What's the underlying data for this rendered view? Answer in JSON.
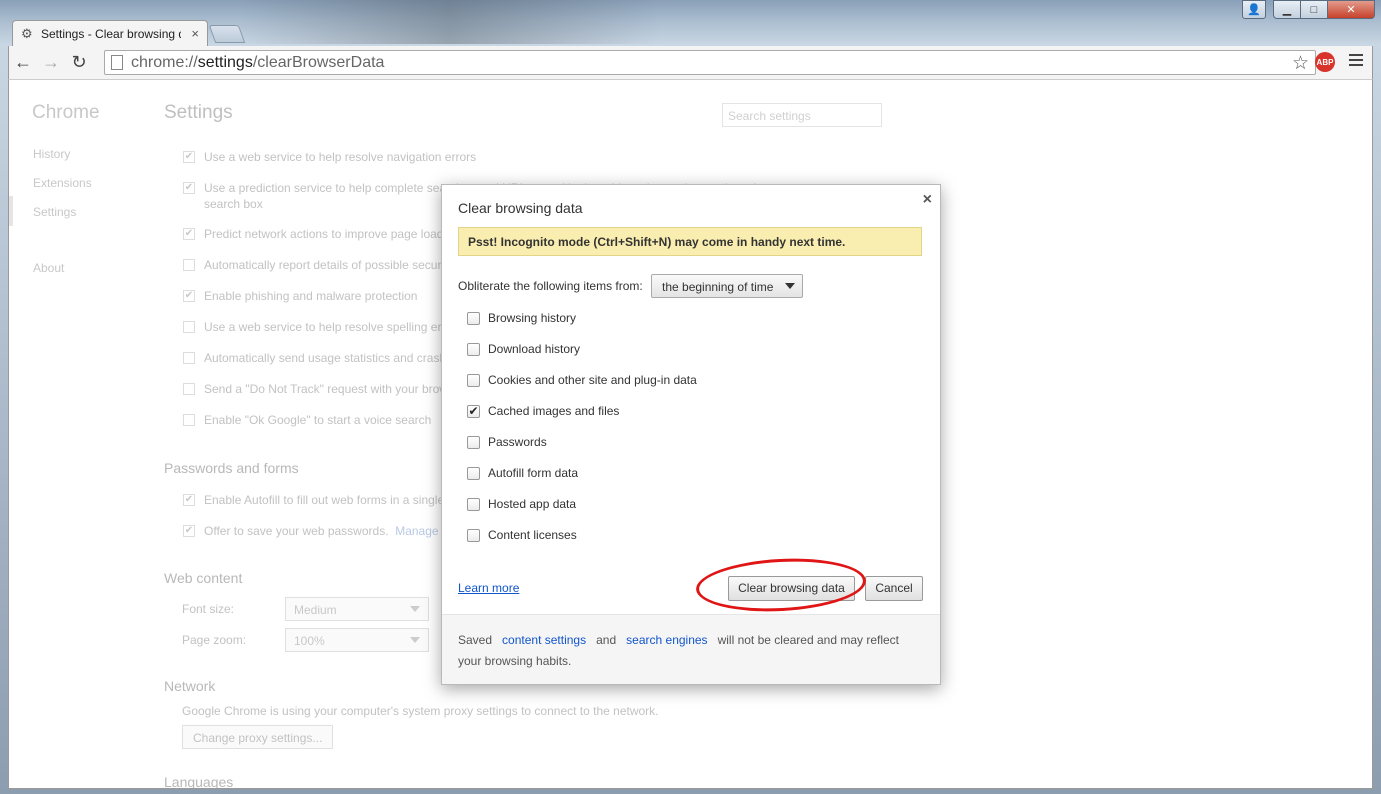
{
  "browser": {
    "tab_title": "Settings - Clear browsing d",
    "tab_close": "×",
    "url_scheme": "chrome://",
    "url_host": "settings",
    "url_path": "/clearBrowserData",
    "abp_label": "ABP"
  },
  "sidebar": {
    "title": "Chrome",
    "items": [
      "History",
      "Extensions",
      "Settings",
      "About"
    ]
  },
  "settings": {
    "title": "Settings",
    "search_placeholder": "Search settings",
    "privacy_options": [
      {
        "label": "Use a web service to help resolve navigation errors",
        "checked": true
      },
      {
        "label": "Use a prediction service to help complete searches and URLs typed in the address bar or the app launcher",
        "checked": true
      },
      {
        "label": "search box",
        "checked": false
      },
      {
        "label": "Predict network actions to improve page load",
        "checked": true
      },
      {
        "label": "Automatically report details of possible secur",
        "checked": false
      },
      {
        "label": "Enable phishing and malware protection",
        "checked": true
      },
      {
        "label": "Use a web service to help resolve spelling err",
        "checked": false
      },
      {
        "label": "Automatically send usage statistics and crash",
        "checked": false
      },
      {
        "label": "Send a \"Do Not Track\" request with your brow",
        "checked": false
      },
      {
        "label": "Enable \"Ok Google\" to start a voice search",
        "checked": false
      }
    ],
    "passwords_section": "Passwords and forms",
    "autofill_label": "Enable Autofill to fill out web forms in a single",
    "save_passwords_label": "Offer to save your web passwords.",
    "manage_link": "Manage p",
    "web_content_section": "Web content",
    "font_size_label": "Font size:",
    "font_size_value": "Medium",
    "page_zoom_label": "Page zoom:",
    "page_zoom_value": "100%",
    "network_section": "Network",
    "network_text": "Google Chrome is using your computer's system proxy settings to connect to the network.",
    "proxy_button": "Change proxy settings...",
    "languages_section": "Languages"
  },
  "dialog": {
    "title": "Clear browsing data",
    "close": "×",
    "promo": "Psst! Incognito mode (Ctrl+Shift+N) may come in handy next time.",
    "obliterate_label": "Obliterate the following items from:",
    "time_range": "the beginning of time",
    "items": [
      {
        "label": "Browsing history",
        "checked": false
      },
      {
        "label": "Download history",
        "checked": false
      },
      {
        "label": "Cookies and other site and plug-in data",
        "checked": false
      },
      {
        "label": "Cached images and files",
        "checked": true
      },
      {
        "label": "Passwords",
        "checked": false
      },
      {
        "label": "Autofill form data",
        "checked": false
      },
      {
        "label": "Hosted app data",
        "checked": false
      },
      {
        "label": "Content licenses",
        "checked": false
      }
    ],
    "learn_more": "Learn more",
    "clear_button": "Clear browsing data",
    "cancel_button": "Cancel",
    "footer_saved": "Saved",
    "footer_content_settings": "content settings",
    "footer_and": "and",
    "footer_search_engines": "search engines",
    "footer_rest": "will not be cleared and may reflect your browsing habits."
  }
}
